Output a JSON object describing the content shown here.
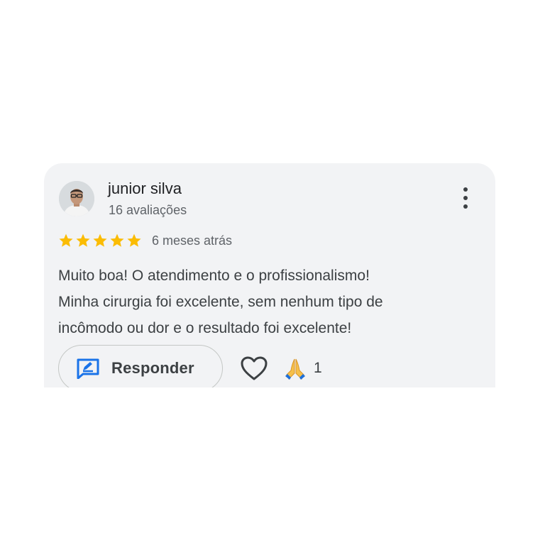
{
  "review": {
    "author": "junior silva",
    "review_count": "16 avaliações",
    "rating": 5,
    "rating_max": 5,
    "time_ago": "6 meses atrás",
    "text_lines": [
      "Muito boa! O atendimento e o profissionalismo!",
      "Minha cirurgia foi excelente, sem nenhum tipo de",
      "incômodo ou dor e o resultado foi excelente!"
    ]
  },
  "actions": {
    "reply_label": "Responder",
    "reply_icon": "reply-icon",
    "like_icon": "heart-outline-icon",
    "reaction_icon": "folded-hands-icon",
    "reaction_count": "1",
    "more_icon": "more-vert-icon"
  },
  "colors": {
    "star": "#fbbc04",
    "reply_icon": "#1a73e8",
    "card_bg": "#f2f3f5"
  }
}
